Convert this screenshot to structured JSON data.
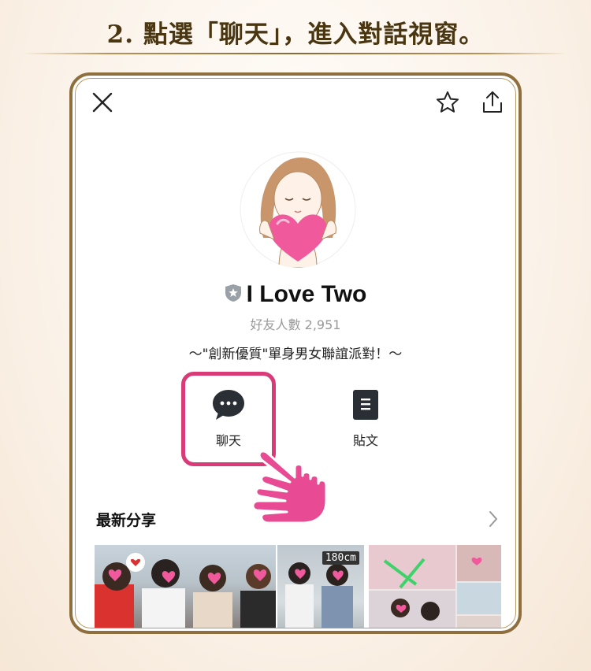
{
  "instruction": "2. 點選「聊天」，進入對話視窗。",
  "profile": {
    "name": "I Love Two",
    "friends_label": "好友人數 2,951",
    "slogan": "～\"創新優質\"單身男女聯誼派對！～"
  },
  "actions": {
    "chat_label": "聊天",
    "post_label": "貼文"
  },
  "section": {
    "title": "最新分享"
  },
  "thumbnail_tag": "180cm",
  "colors": {
    "highlight": "#d93b78",
    "frame": "#8e6f3d",
    "title_text": "#4a3712"
  },
  "icons": [
    "close-icon",
    "star-icon",
    "share-icon",
    "verified-shield-icon",
    "chat-bubble-icon",
    "post-document-icon",
    "chevron-right-icon",
    "pointing-hand-icon"
  ]
}
